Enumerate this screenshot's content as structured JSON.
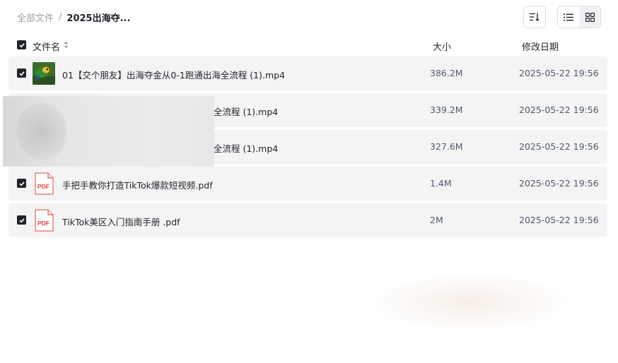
{
  "breadcrumb": {
    "root": "全部文件",
    "separator": "/",
    "current": "2025出海夺..."
  },
  "toolbar": {
    "sort_icon": "sort-icon",
    "list_icon": "list-view-icon",
    "grid_icon": "grid-view-icon"
  },
  "header": {
    "name": "文件名",
    "size": "大小",
    "date": "修改日期"
  },
  "files": [
    {
      "name": "01【交个朋友】出海夺金从0-1跑通出海全流程 (1).mp4",
      "size": "386.2M",
      "date": "2025-05-22 19:56",
      "type": "video"
    },
    {
      "name": "全流程 (1).mp4",
      "size": "339.2M",
      "date": "2025-05-22 19:56",
      "type": "video"
    },
    {
      "name": "全流程 (1).mp4",
      "size": "327.6M",
      "date": "2025-05-22 19:56",
      "type": "video"
    },
    {
      "name": "手把手教你打造TikTok爆款短视频.pdf",
      "size": "1.4M",
      "date": "2025-05-22 19:56",
      "type": "pdf"
    },
    {
      "name": "TikTok美区入门指南手册 .pdf",
      "size": "2M",
      "date": "2025-05-22 19:56",
      "type": "pdf"
    }
  ],
  "pdf_label": "PDF",
  "colors": {
    "row_bg": "#f4f4f5",
    "checkbox": "#1f2329",
    "pdf_red": "#e5453d"
  }
}
